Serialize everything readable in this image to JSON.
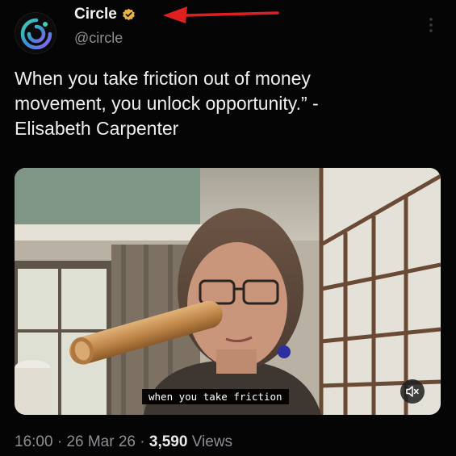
{
  "author": {
    "display_name": "Circle",
    "handle": "@circle",
    "avatar_icon": "circle-logo-icon",
    "verified_icon": "verified-badge-icon",
    "brand_color": "#3b8fd9"
  },
  "tweet": {
    "lines": [
      "When you take friction out of money",
      "movement, you unlock opportunity.” -",
      "Elisabeth Carpenter"
    ]
  },
  "media": {
    "caption": "when you take friction",
    "mute_icon": "speaker-muted-icon"
  },
  "meta": {
    "time": "16:00",
    "sep1": " · ",
    "date": "26 Mar 26",
    "sep2": " · ",
    "views_count": "3,590",
    "views_label": " Views"
  },
  "annotation": {
    "arrow_color": "#e02020",
    "arrow_icon": "red-arrow-icon"
  },
  "more_icon": "more-options-icon"
}
